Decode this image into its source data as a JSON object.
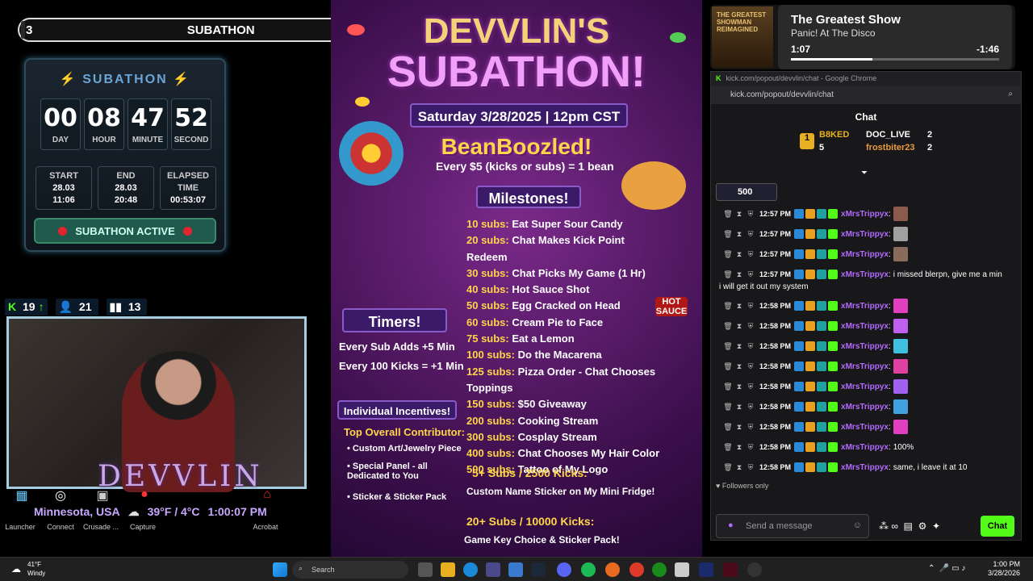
{
  "progress": {
    "current": "3",
    "title": "SUBATHON",
    "goal": "500",
    "fraction": 0.006
  },
  "timer": {
    "title": "SUBATHON",
    "units": [
      {
        "value": "00",
        "label": "DAY"
      },
      {
        "value": "08",
        "label": "HOUR"
      },
      {
        "value": "47",
        "label": "MINUTE"
      },
      {
        "value": "52",
        "label": "SECOND"
      }
    ],
    "start": {
      "label": "START",
      "date": "28.03",
      "time": "11:06"
    },
    "end": {
      "label": "END",
      "date": "28.03",
      "time": "20:48"
    },
    "elapsed": {
      "label1": "ELAPSED",
      "label2": "TIME",
      "value": "00:53:07"
    },
    "status": "SUBATHON ACTIVE"
  },
  "stats": {
    "kick": "19",
    "viewers": "21",
    "bars": "13"
  },
  "overlay": {
    "brand": "DEVVLIN",
    "location": "Minnesota, USA",
    "temp": "39°F / 4°C",
    "time": "1:00:07 PM"
  },
  "desktop_icons": [
    "Launcher",
    "Connect",
    "Crusade ...",
    "Capture",
    "Acrobat"
  ],
  "poster": {
    "title1": "DEVVLIN'S",
    "title2": "SUBATHON!",
    "date": "Saturday 3/28/2025 | 12pm CST",
    "bean_title": "BeanBoozled!",
    "bean_sub": "Every $5 (kicks or subs) = 1 bean",
    "milestones_title": "Milestones!",
    "milestones": [
      {
        "k": "10 subs:",
        "v": "Eat Super Sour Candy"
      },
      {
        "k": "20 subs:",
        "v": "Chat Makes Kick Point Redeem"
      },
      {
        "k": "30 subs:",
        "v": "Chat Picks My Game (1 Hr)"
      },
      {
        "k": "40 subs:",
        "v": "Hot Sauce Shot"
      },
      {
        "k": "50 subs:",
        "v": "Egg Cracked on Head"
      },
      {
        "k": "60 subs:",
        "v": "Cream Pie to Face"
      },
      {
        "k": "75 subs:",
        "v": "Eat a Lemon"
      },
      {
        "k": "100 subs:",
        "v": "Do the Macarena"
      },
      {
        "k": "125 subs:",
        "v": "Pizza Order - Chat Chooses Toppings"
      },
      {
        "k": "150 subs:",
        "v": "$50 Giveaway"
      },
      {
        "k": "200 subs:",
        "v": "Cooking Stream"
      },
      {
        "k": "300 subs:",
        "v": "Cosplay Stream"
      },
      {
        "k": "400 subs:",
        "v": "Chat Chooses My Hair Color"
      },
      {
        "k": "500 subs:",
        "v": "Tattoo of My Logo"
      }
    ],
    "timers_title": "Timers!",
    "timers": [
      "Every Sub Adds +5 Min",
      "Every 100 Kicks = +1 Min"
    ],
    "incentives_title": "Individual Incentives!",
    "top_contrib": "Top Overall Contributor:",
    "incentives": [
      "Custom Art/Jewelry Piece",
      "Special Panel - all Dedicated to You",
      "Sticker & Sticker Pack"
    ],
    "tier1_title": "5+ Subs / 2500 Kicks:",
    "tier1_text": "Custom Name Sticker on My Mini Fridge!",
    "tier2_title": "20+ Subs / 10000 Kicks:",
    "tier2_text": "Game Key Choice & Sticker Pack!",
    "hot_sauce": "HOT SAUCE"
  },
  "music": {
    "art_text": "THE GREATEST SHOWMAN REIMAGINED",
    "title": "The Greatest Show",
    "artist": "Panic! At The Disco",
    "elapsed": "1:07",
    "remaining": "-1:46",
    "progress": 0.39
  },
  "chat": {
    "window_title": "kick.com/popout/devvlin/chat - Google Chrome",
    "url": "kick.com/popout/devvlin/chat",
    "header": "Chat",
    "leaderboard": [
      {
        "name": "B8KED",
        "count": "5"
      },
      {
        "name": "DOC_LIVE",
        "count": "2"
      },
      {
        "name": "frostbiter23",
        "count": "2"
      }
    ],
    "pinned": "500",
    "messages": [
      {
        "time": "12:57 PM",
        "user": "xMrsTrippyx",
        "text": ""
      },
      {
        "time": "12:57 PM",
        "user": "xMrsTrippyx",
        "text": ""
      },
      {
        "time": "12:57 PM",
        "user": "xMrsTrippyx",
        "text": ""
      },
      {
        "time": "12:57 PM",
        "user": "xMrsTrippyx",
        "text": "i missed blerpn, give me a min"
      },
      {
        "time": "12:58 PM",
        "user": "xMrsTrippyx",
        "text": ""
      },
      {
        "time": "12:58 PM",
        "user": "xMrsTrippyx",
        "text": ""
      },
      {
        "time": "12:58 PM",
        "user": "xMrsTrippyx",
        "text": ""
      },
      {
        "time": "12:58 PM",
        "user": "xMrsTrippyx",
        "text": ""
      },
      {
        "time": "12:58 PM",
        "user": "xMrsTrippyx",
        "text": ""
      },
      {
        "time": "12:58 PM",
        "user": "xMrsTrippyx",
        "text": ""
      },
      {
        "time": "12:58 PM",
        "user": "xMrsTrippyx",
        "text": ""
      },
      {
        "time": "12:58 PM",
        "user": "xMrsTrippyx",
        "text": "100%"
      },
      {
        "time": "12:58 PM",
        "user": "xMrsTrippyx",
        "text": "same, i leave it at 10"
      }
    ],
    "continuation": "i will get it out my system",
    "followers_only": "Followers only",
    "input_placeholder": "Send a message",
    "send_label": "Chat"
  },
  "taskbar": {
    "temp": "41°F",
    "weather": "Windy",
    "search_placeholder": "Search",
    "time": "1:00 PM",
    "date": "3/28/2026"
  },
  "colors": {
    "kick_green": "#53fc18",
    "username": "#b36bff",
    "accent_gold": "#ffd54a"
  }
}
